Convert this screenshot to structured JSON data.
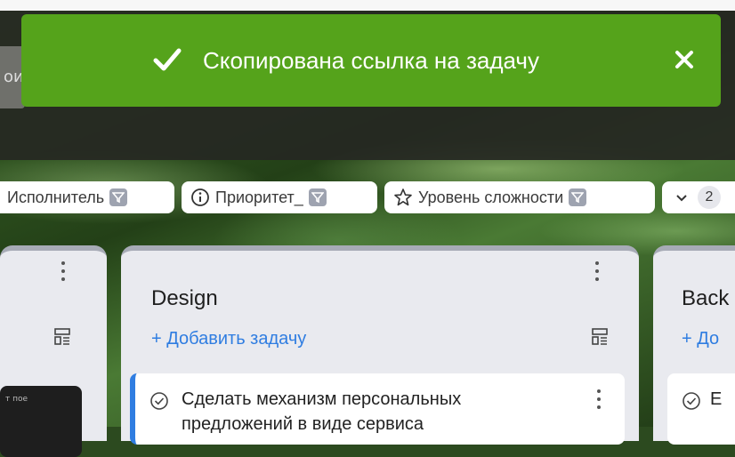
{
  "toast": {
    "message": "Скопирована ссылка на задачу",
    "icon": "check-icon",
    "close_icon": "close-icon",
    "color": "#55a31b"
  },
  "header": {
    "partial_field_text": "ои"
  },
  "filters": [
    {
      "label": "Исполнитель"
    },
    {
      "label": "Приоритет_"
    },
    {
      "label": "Уровень сложности"
    },
    {
      "label": "2"
    }
  ],
  "columns": [
    {
      "title": "",
      "thumb_text": "т пое"
    },
    {
      "title": "Design",
      "add_label": "+ Добавить задачу",
      "card": {
        "title_line1": "Сделать механизм персональных",
        "title_line2": "предложений в виде сервиса"
      }
    },
    {
      "title": "Back",
      "add_label": "+ До",
      "card": {
        "title_line1": "Е"
      }
    }
  ]
}
